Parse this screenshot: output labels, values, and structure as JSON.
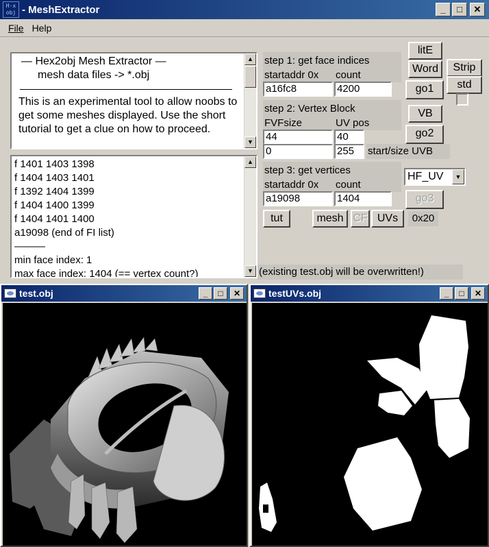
{
  "window": {
    "title": "MeshExtractor",
    "logo_text": "H2O"
  },
  "menu": [
    {
      "label": "File"
    },
    {
      "label": "Help"
    }
  ],
  "info_panel": {
    "heading_line1": "—   Hex2obj Mesh Extractor   —",
    "heading_line2": "mesh data files -> *.obj",
    "body": "This is an experimental tool to allow noobs to get some meshes displayed. Use the short tutorial to get a clue on how to proceed."
  },
  "log_panel": {
    "lines": [
      "f  1401 1403 1398",
      "f  1404 1403 1401",
      "f  1392 1404 1399",
      "f  1404 1400 1399",
      "f  1404 1401 1400",
      "a19098 (end of FI list)",
      "———",
      "min face index: 1",
      "max face index: 1404 (== vertex count?)"
    ]
  },
  "step1": {
    "title": "step 1: get face indices",
    "addr_label": "startaddr 0x",
    "count_label": "count",
    "addr_value": "a16fc8",
    "count_value": "4200"
  },
  "step2": {
    "title": "step 2: Vertex Block",
    "fvf_label": "FVFsize",
    "uvpos_label": "UV pos",
    "fvf_value": "44",
    "uvpos_value": "40",
    "uvb_start_value": "0",
    "uvb_size_value": "255",
    "uvb_label": "start/size UVB"
  },
  "step3": {
    "title": "step 3: get vertices",
    "addr_label": "startaddr 0x",
    "count_label": "count",
    "addr_value": "a19098",
    "count_value": "1404",
    "uv_mode": "HF_UV"
  },
  "buttons": {
    "lite": "litE",
    "word": "Word",
    "strip": "Strip",
    "std": "std",
    "go1": "go1",
    "vb": "VB",
    "go2": "go2",
    "go3": "go3",
    "tut": "tut",
    "mesh": "mesh",
    "cf": "CF",
    "uvs": "UVs"
  },
  "stride_value": "0x20",
  "warning": "(existing test.obj will be overwritten!)",
  "viewer_mesh": {
    "title": "test.obj"
  },
  "viewer_uv": {
    "title": "testUVs.obj"
  },
  "colors": {
    "titlebar_start": "#0a246a",
    "titlebar_end": "#3a6ea5",
    "face": "#d4d0c8"
  }
}
